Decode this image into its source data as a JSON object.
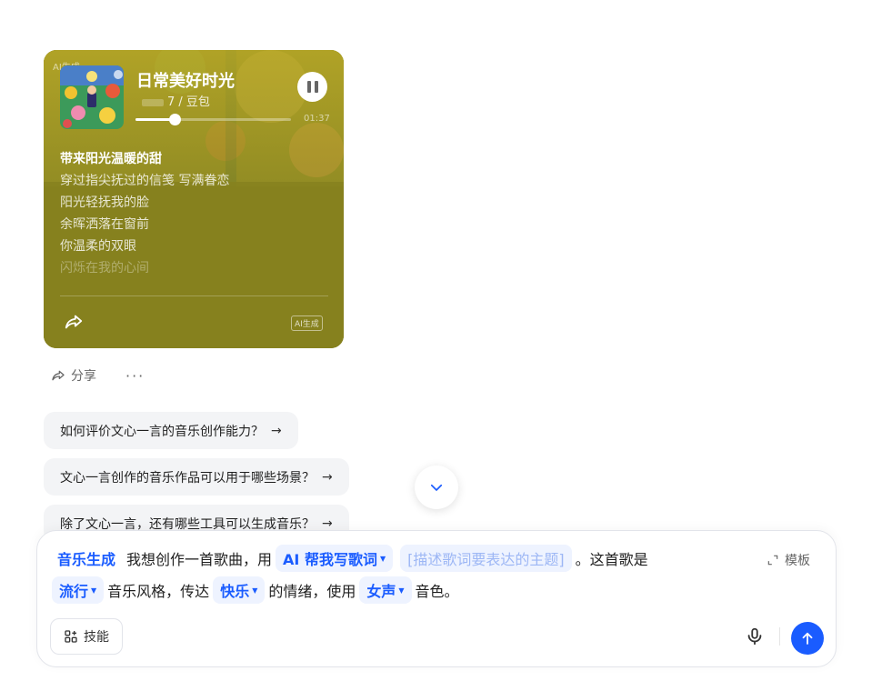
{
  "music_card": {
    "badge_top": "AI生成",
    "title": "日常美好时光",
    "meta": "7 / 豆包",
    "time": "01:37",
    "progress": 0.25,
    "lyrics": [
      "带来阳光温暖的甜",
      "穿过指尖抚过的信笺 写满眷恋",
      "阳光轻抚我的脸",
      "余晖洒落在窗前",
      "你温柔的双眼",
      "闪烁在我的心间"
    ],
    "ai_label": "AI生成",
    "bg_color": "#86811e"
  },
  "actions": {
    "share_label": "分享",
    "more_label": "···"
  },
  "suggestions": [
    "如何评价文心一言的音乐创作能力？",
    "文心一言创作的音乐作品可以用于哪些场景？",
    "除了文心一言，还有哪些工具可以生成音乐？"
  ],
  "suggestion_arrow": "→",
  "composer": {
    "skill": "音乐生成",
    "text_1": "我想创作一首歌曲，用",
    "chip_ai": "AI 帮我写歌词",
    "chip_placeholder": "[描述歌词要表达的主题]",
    "text_2": "。这首歌是",
    "chip_genre": "流行",
    "text_3": "音乐风格，传达",
    "chip_emotion": "快乐",
    "text_4": "的情绪，使用",
    "chip_voice": "女声",
    "text_5": "音色。",
    "template_label": "模板",
    "skills_label": "技能",
    "accent": "#1a5cff"
  }
}
